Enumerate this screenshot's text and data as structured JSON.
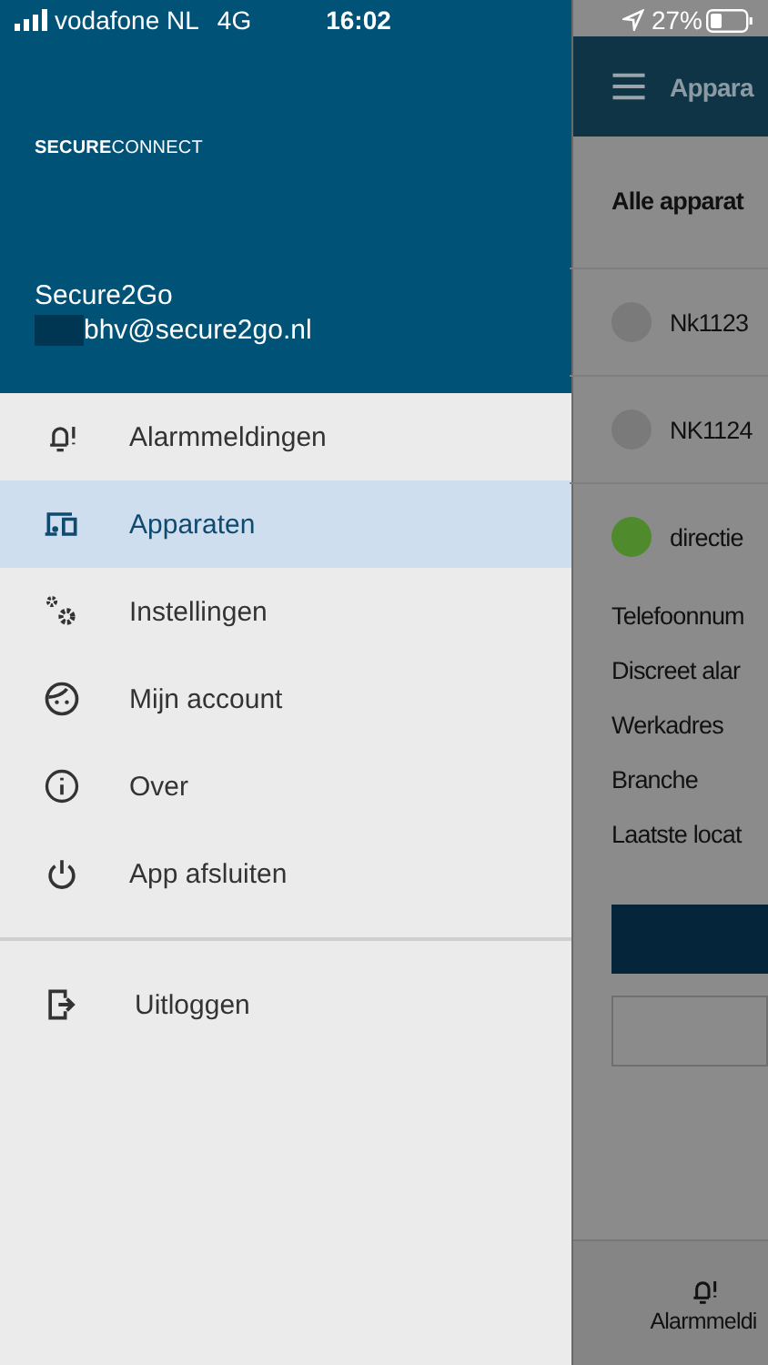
{
  "status_bar": {
    "carrier": "vodafone NL",
    "network": "4G",
    "time": "16:02",
    "battery": "27%"
  },
  "drawer": {
    "logo_bold": "SECURE",
    "logo_light": "CONNECT",
    "user_name": "Secure2Go",
    "user_email": "bhv@secure2go.nl",
    "items": [
      {
        "kind": "alarm",
        "label": "Alarmmeldingen",
        "selected": false
      },
      {
        "kind": "devices",
        "label": "Apparaten",
        "selected": true
      },
      {
        "kind": "settings",
        "label": "Instellingen",
        "selected": false
      },
      {
        "kind": "account",
        "label": "Mijn account",
        "selected": false
      },
      {
        "kind": "info",
        "label": "Over",
        "selected": false
      },
      {
        "kind": "power",
        "label": "App afsluiten",
        "selected": false
      }
    ],
    "logout": {
      "label": "Uitloggen"
    }
  },
  "background_screen": {
    "title": "Appara",
    "section": "Alle apparat",
    "devices": [
      {
        "name": "Nk1123",
        "color": "#7a7a7a"
      },
      {
        "name": "NK1124",
        "color": "#7a7a7a"
      },
      {
        "name": "directie",
        "color": "#4f8a2c"
      }
    ],
    "details": [
      "Telefoonnum",
      "Discreet alar",
      "Werkadres",
      "Branche",
      "Laatste locat"
    ],
    "bottom_nav": {
      "label": "Alarmmeldi"
    }
  }
}
